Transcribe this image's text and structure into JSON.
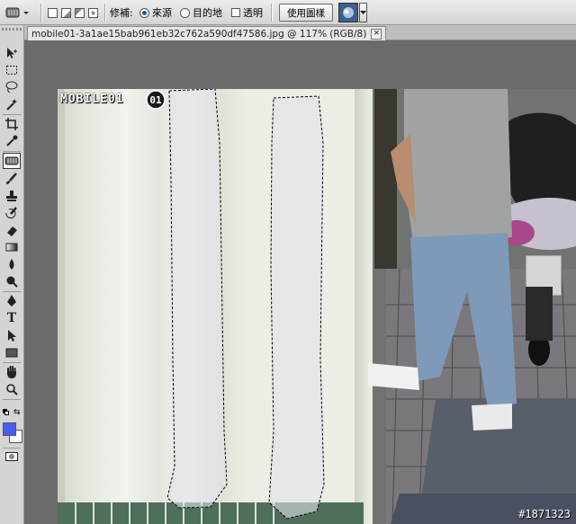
{
  "options_bar": {
    "patch_label": "修補:",
    "source_label": "來源",
    "destination_label": "目的地",
    "transparent_label": "透明",
    "use_pattern_label": "使用圖樣",
    "source_selected": true
  },
  "document": {
    "tab_title": "mobile01-3a1ae15bab961eb32c762a590df47586.jpg @ 117% (RGB/8)",
    "close_glyph": "×"
  },
  "photo": {
    "logo_text": "MOBILE01",
    "watermark": "#1871323"
  },
  "colors": {
    "foreground": "#4a5cf0",
    "background": "#ffffff",
    "ui_bg": "#d4d4d4",
    "workspace": "#6b6b6b"
  },
  "tools": [
    "move-tool-icon",
    "marquee-tool-icon",
    "lasso-tool-icon",
    "magic-wand-tool-icon",
    "crop-tool-icon",
    "eyedropper-tool-icon",
    "patch-tool-icon",
    "brush-tool-icon",
    "clone-stamp-tool-icon",
    "history-brush-tool-icon",
    "eraser-tool-icon",
    "gradient-tool-icon",
    "blur-tool-icon",
    "dodge-tool-icon",
    "pen-tool-icon",
    "type-tool-icon",
    "path-selection-tool-icon",
    "rectangle-tool-icon",
    "hand-tool-icon",
    "zoom-tool-icon"
  ]
}
